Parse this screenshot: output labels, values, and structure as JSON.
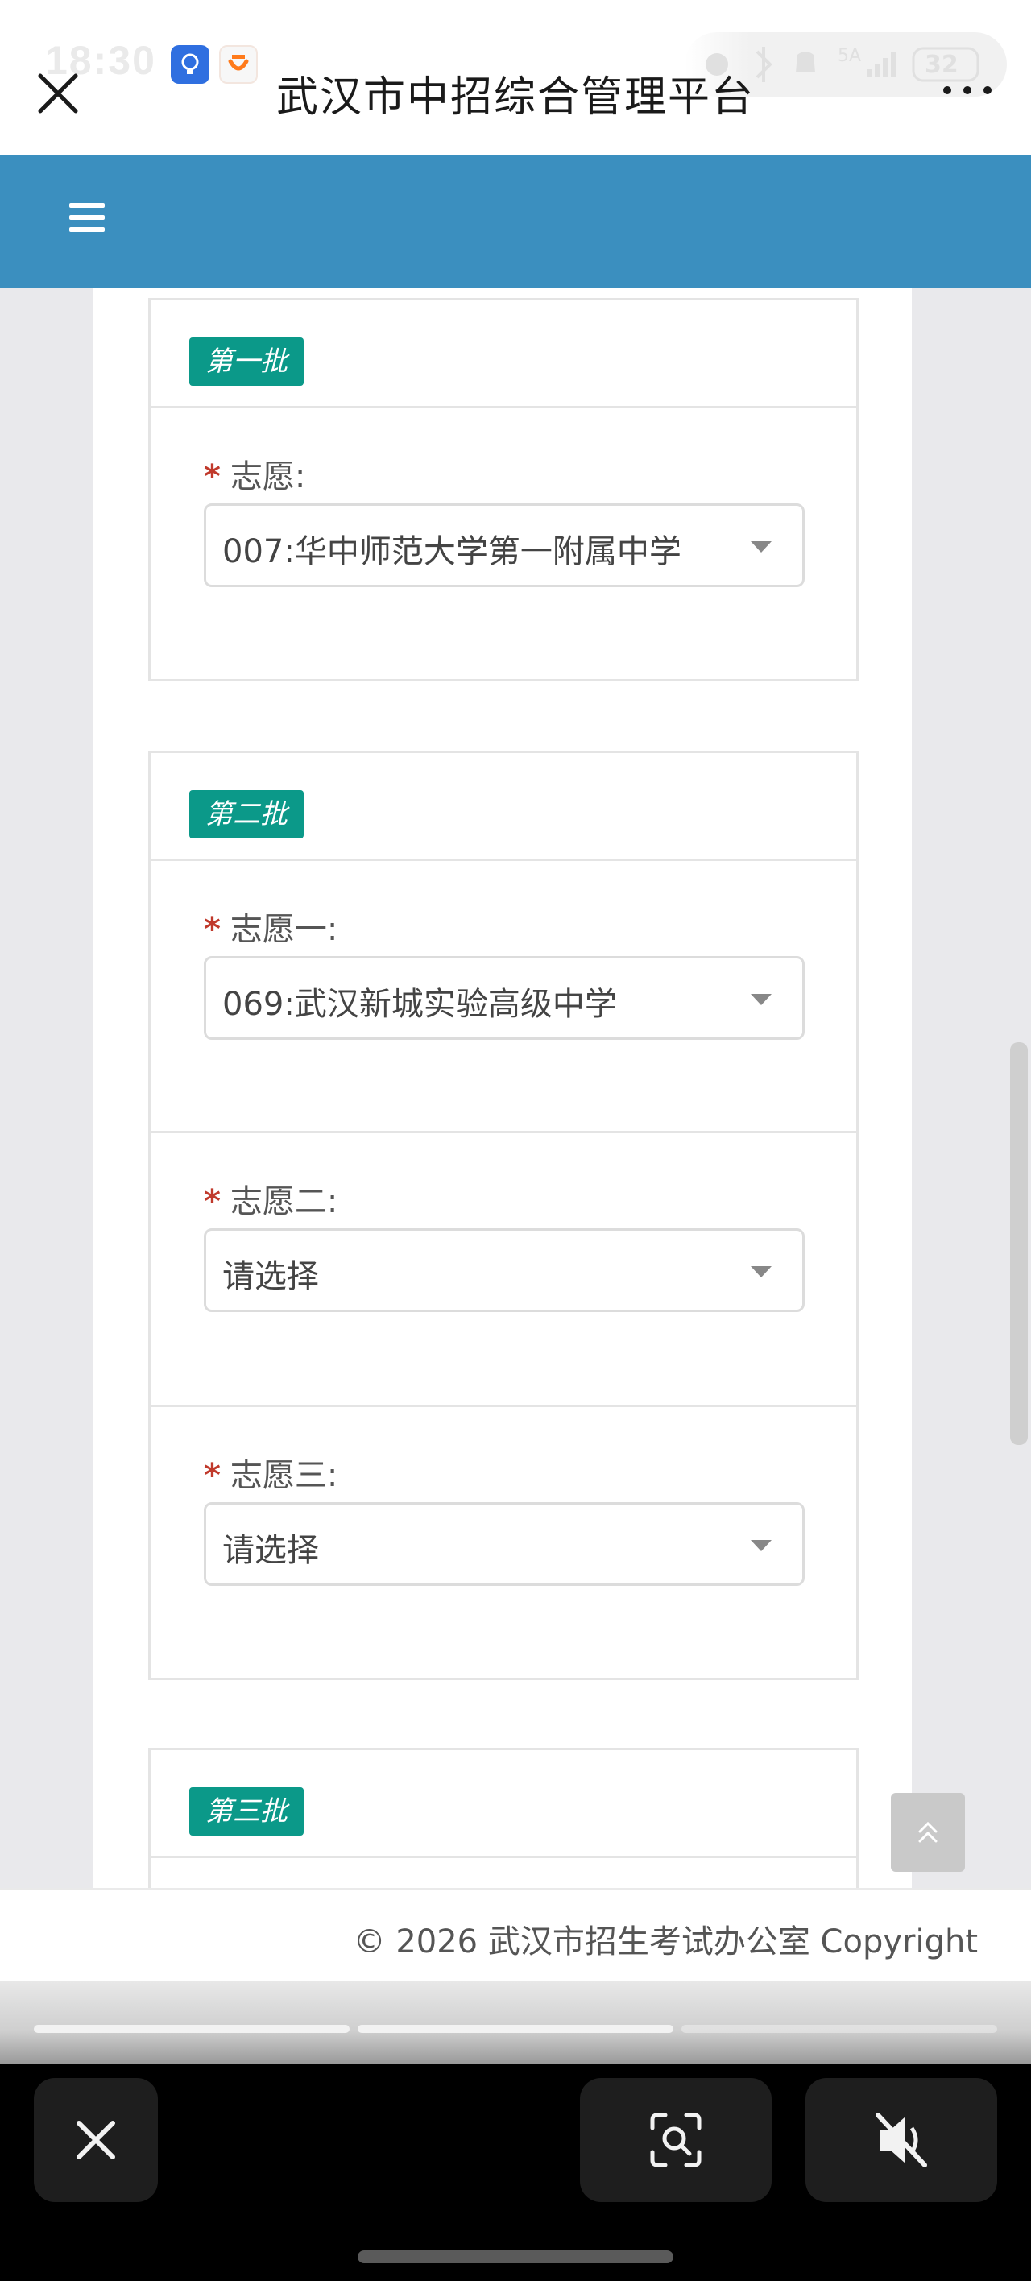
{
  "status": {
    "time": "18:30",
    "network": "5A",
    "battery": "32"
  },
  "browser": {
    "title": "武汉市中招综合管理平台"
  },
  "batches": [
    {
      "badge": "第一批",
      "fields": [
        {
          "label": "志愿:",
          "value": "007:华中师范大学第一附属中学"
        }
      ]
    },
    {
      "badge": "第二批",
      "fields": [
        {
          "label": "志愿一:",
          "value": "069:武汉新城实验高级中学"
        },
        {
          "label": "志愿二:",
          "value": "请选择"
        },
        {
          "label": "志愿三:",
          "value": "请选择"
        }
      ]
    },
    {
      "badge": "第三批",
      "fields": []
    }
  ],
  "required_mark": "*",
  "footer": {
    "copyright": "© 2026 武汉市招生考试办公室 Copyright"
  },
  "colors": {
    "nav": "#3b8fbf",
    "badge": "#0b9989",
    "required": "#c0392b"
  },
  "icons": {
    "close": "close-icon",
    "more": "more-icon",
    "menu": "hamburger-icon",
    "scroll_top": "double-chevron-up-icon",
    "screenshot": "screenshot-icon",
    "mute": "mute-icon"
  }
}
